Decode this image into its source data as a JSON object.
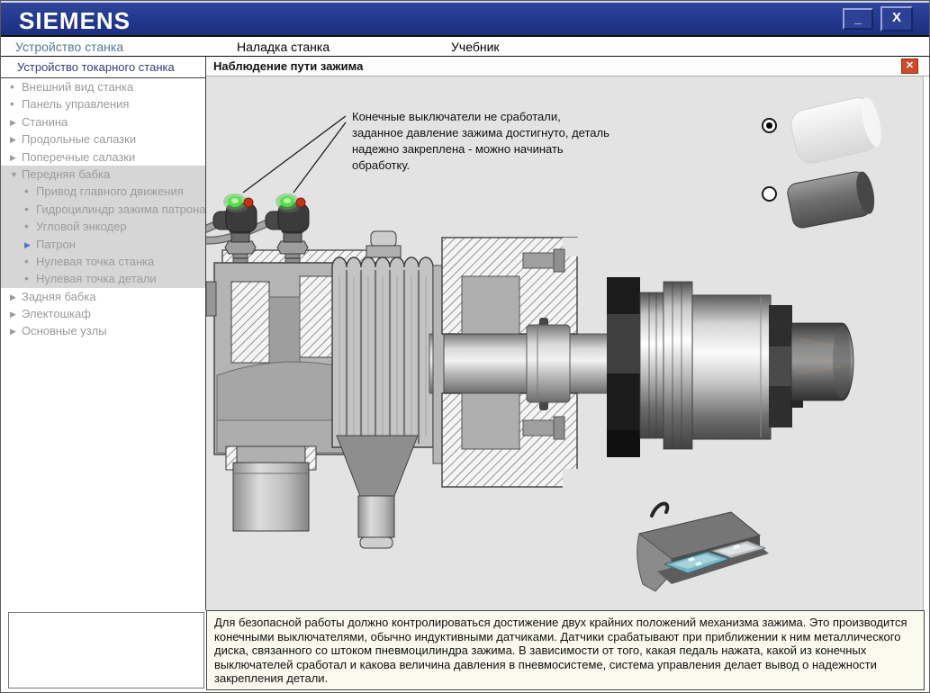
{
  "window": {
    "brand": "SIEMENS",
    "minimize_label": "_",
    "close_label": "X"
  },
  "tabs": [
    {
      "label": "Устройство станка",
      "active": true
    },
    {
      "label": "Наладка станка",
      "active": false
    },
    {
      "label": "Учебник",
      "active": false
    }
  ],
  "sidebar": {
    "header": "Устройство токарного станка",
    "items": [
      {
        "label": "Внешний вид станка",
        "marker": "•",
        "level": 0,
        "highlighted": false
      },
      {
        "label": "Панель управления",
        "marker": "•",
        "level": 0,
        "highlighted": false
      },
      {
        "label": "Станина",
        "marker": "▶",
        "level": 0,
        "highlighted": false
      },
      {
        "label": "Продольные салазки",
        "marker": "▶",
        "level": 0,
        "highlighted": false
      },
      {
        "label": "Поперечные салазки",
        "marker": "▶",
        "level": 0,
        "highlighted": false
      },
      {
        "label": "Передняя бабка",
        "marker": "▼",
        "level": 0,
        "highlighted": true
      },
      {
        "label": "Привод главного движения",
        "marker": "•",
        "level": 1,
        "highlighted": true
      },
      {
        "label": "Гидроцилиндр зажима патрона",
        "marker": "•",
        "level": 1,
        "highlighted": true
      },
      {
        "label": "Угловой энкодер",
        "marker": "•",
        "level": 1,
        "highlighted": true
      },
      {
        "label": "Патрон",
        "marker": "▶",
        "level": 1,
        "highlighted": true,
        "accent": true
      },
      {
        "label": "Нулевая точка станка",
        "marker": "•",
        "level": 1,
        "highlighted": true
      },
      {
        "label": "Нулевая точка детали",
        "marker": "•",
        "level": 1,
        "highlighted": true
      },
      {
        "label": "Задняя бабка",
        "marker": "▶",
        "level": 0,
        "highlighted": false
      },
      {
        "label": "Электошкаф",
        "marker": "▶",
        "level": 0,
        "highlighted": false
      },
      {
        "label": "Основные узлы",
        "marker": "▶",
        "level": 0,
        "highlighted": false
      }
    ]
  },
  "panel": {
    "title": "Наблюдение пути зажима",
    "close_icon": "✕",
    "annotation": "Конечные выключатели не сработали, заданное давление зажима достигнуто, деталь надежно закреплена  -  можно начинать обработку.",
    "options": [
      {
        "name": "light-plastic-workpiece",
        "selected": true
      },
      {
        "name": "dark-metal-workpiece",
        "selected": false
      }
    ]
  },
  "footer": {
    "description": "Для безопасной работы должно контролироваться достижение двух крайних положений механизма зажима. Это производится конечными выключателями, обычно индуктивными датчиками. Датчики срабатывают при приближении к ним металлического диска, связанного со штоком пневмоцилиндра зажима. В зависимости от того, какая педаль нажата, какой из конечных выключателей сработал и какова величина давления в пневмосистеме, система управления делает вывод о надежности закрепления детали."
  },
  "colors": {
    "titlebar_blue": "#22378c",
    "active_tab": "#4e7d96",
    "close_button_red": "#d0492b",
    "highlight_gray": "#d6d6d6",
    "canvas_gray": "#e3e3e3",
    "footer_cream": "#fbfaee",
    "led_green": "#4ad43c",
    "led_red": "#c63418"
  }
}
